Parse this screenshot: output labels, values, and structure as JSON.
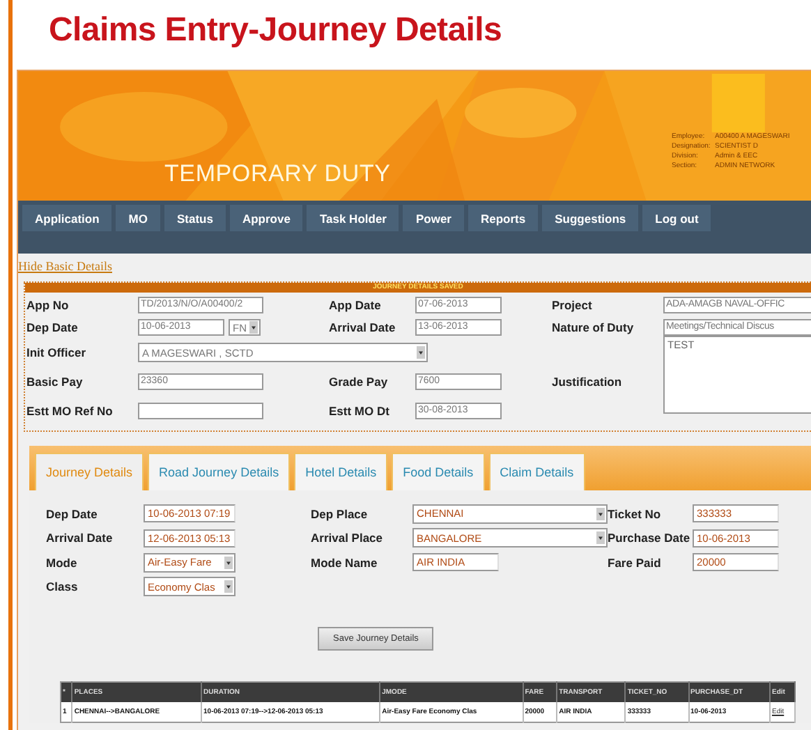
{
  "page_title": "Claims Entry-Journey Details",
  "banner": {
    "title": "TEMPORARY DUTY",
    "user_info": [
      {
        "label": "Employee:",
        "value": "A00400 A MAGESWARI"
      },
      {
        "label": "Designation:",
        "value": "SCIENTIST D"
      },
      {
        "label": "Division:",
        "value": "Admin & EEC"
      },
      {
        "label": "Section:",
        "value": "ADMIN NETWORK"
      }
    ]
  },
  "nav": [
    "Application",
    "MO",
    "Status",
    "Approve",
    "Task Holder",
    "Power",
    "Reports",
    "Suggestions",
    "Log out"
  ],
  "basic_details": {
    "toggle": "Hide Basic Details",
    "status": "JOURNEY DETAILS SAVED",
    "rows": [
      [
        {
          "label": "App No",
          "kind": "text",
          "value": "TD/2013/N/O/A00400/2"
        },
        {
          "label": "App Date",
          "kind": "text",
          "value": "07-06-2013"
        },
        {
          "label": "Project",
          "kind": "text",
          "value": "ADA-AMAGB NAVAL-OFFIC"
        }
      ],
      [
        {
          "label": "Dep Date",
          "kind": "date_session",
          "value": "10-06-2013",
          "session": "FN"
        },
        {
          "label": "Arrival Date",
          "kind": "text",
          "value": "13-06-2013"
        },
        {
          "label": "Nature of Duty",
          "kind": "text",
          "value": "Meetings/Technical Discus"
        }
      ],
      [
        {
          "label": "Init Officer",
          "kind": "wide_select",
          "value": "A MAGESWARI , SCTD"
        }
      ],
      [
        {
          "label": "Basic Pay",
          "kind": "text",
          "value": "23360"
        },
        {
          "label": "Grade Pay",
          "kind": "text",
          "value": "7600"
        },
        {
          "label": "Justification",
          "kind": "textarea",
          "value": "TEST"
        }
      ],
      [
        {
          "label": "Estt MO Ref No",
          "kind": "text"
        },
        {
          "label": "Estt MO Dt",
          "kind": "text",
          "value": "30-08-2013"
        }
      ]
    ]
  },
  "tabs": [
    {
      "label": "Journey Details",
      "selected": true
    },
    {
      "label": "Road Journey Details",
      "selected": false
    },
    {
      "label": "Hotel Details",
      "selected": false
    },
    {
      "label": "Food Details",
      "selected": false
    },
    {
      "label": "Claim Details",
      "selected": false
    }
  ],
  "journey": {
    "rows": [
      [
        {
          "label": "Dep Date",
          "kind": "text",
          "value": "10-06-2013 07:19"
        },
        {
          "label": "Dep Place",
          "kind": "select",
          "value": "CHENNAI"
        },
        {
          "label": "Ticket No",
          "kind": "text",
          "value": "333333"
        }
      ],
      [
        {
          "label": "Arrival Date",
          "kind": "text",
          "value": "12-06-2013 05:13"
        },
        {
          "label": "Arrival Place",
          "kind": "select",
          "value": "BANGALORE"
        },
        {
          "label": "Purchase Date",
          "kind": "text",
          "value": "10-06-2013"
        }
      ],
      [
        {
          "label": "Mode",
          "kind": "select",
          "value": "Air-Easy Fare"
        },
        {
          "label": "Mode Name",
          "kind": "text",
          "value": "AIR INDIA"
        },
        {
          "label": "Fare Paid",
          "kind": "text",
          "value": "20000"
        }
      ],
      [
        {
          "label": "Class",
          "kind": "select",
          "value": "Economy Clas"
        }
      ]
    ],
    "save_button": "Save Journey Details"
  },
  "table": {
    "columns": [
      "*",
      "PLACES",
      "DURATION",
      "JMODE",
      "FARE",
      "TRANSPORT",
      "TICKET_NO",
      "PURCHASE_DT",
      "Edit"
    ],
    "rows": [
      [
        "1",
        "CHENNAI-->BANGALORE",
        "10-06-2013 07:19-->12-06-2013 05:13",
        "Air-Easy Fare Economy Clas",
        "20000",
        "AIR INDIA",
        "333333",
        "10-06-2013",
        "Edit"
      ]
    ]
  }
}
